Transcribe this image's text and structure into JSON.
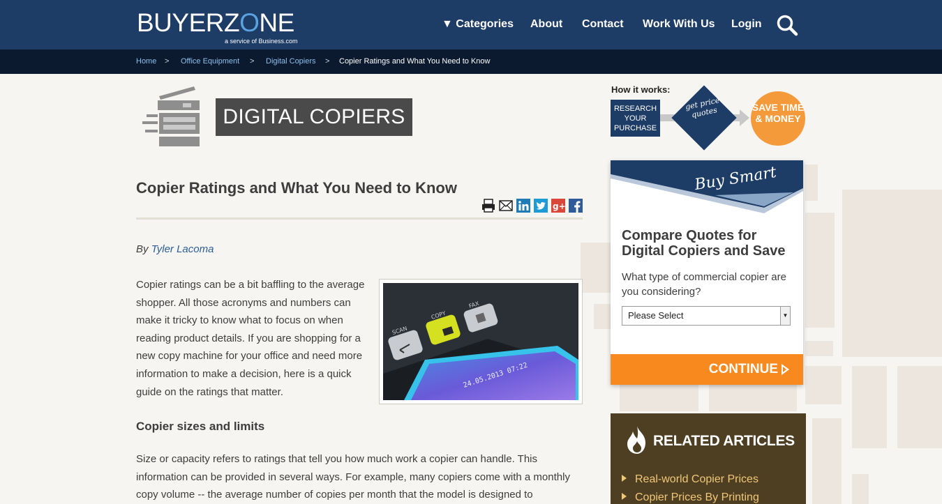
{
  "header": {
    "logo_main": "BUYERZ",
    "logo_o": "O",
    "logo_end": "NE",
    "logo_sub": "a service of Business.com",
    "nav": [
      "▼ Categories",
      "About",
      "Contact",
      "Work With Us",
      "Login"
    ],
    "search_icon": "search-icon"
  },
  "breadcrumb": {
    "items": [
      "Home",
      "Office Equipment",
      "Digital Copiers"
    ],
    "current": "Copier Ratings and What You Need to Know",
    "separator": ">"
  },
  "category": {
    "icon": "copier-icon",
    "banner": "DIGITAL COPIERS"
  },
  "article": {
    "title": "Copier Ratings and What You Need to Know",
    "share_icons": [
      "print-icon",
      "email-icon",
      "linkedin-icon",
      "twitter-icon",
      "googleplus-icon",
      "facebook-icon"
    ],
    "byline_prefix": "By",
    "author": "Tyler Lacoma",
    "intro": "Copier ratings can be a bit baffling to the average shopper. All those acronyms and numbers can make it tricky to know what to focus on when reading product details. If you are shopping for a new copy machine for your office and need more information to make a decision, here is a quick guide on the ratings that matter.",
    "photo_labels": {
      "scan": "SCAN",
      "copy": "COPY",
      "fax": "FAX",
      "date": "24.05.2013 07:22"
    },
    "subhead": "Copier sizes and limits",
    "body": "Size or capacity refers to ratings that tell you how much work a copier can handle. This information can be provided in several ways. For example, many copiers come with a monthly copy volume -- the average number of copies per month that the model is designed to"
  },
  "how_it_works": {
    "label": "How it works:",
    "step1": "RESEARCH YOUR PURCHASE",
    "step2": "get price quotes",
    "step3": "SAVE TIME & MONEY"
  },
  "quote": {
    "banner": "Buy Smart",
    "title": "Compare Quotes for Digital Copiers and Save",
    "question": "What type of commercial copier are you considering?",
    "select_value": "Please Select",
    "continue_label": "CONTINUE"
  },
  "related": {
    "title": "RELATED ARTICLES",
    "items": [
      "Real-world Copier Prices",
      "Copier Prices By Printing"
    ]
  },
  "colors": {
    "header_bg": "#1d3c66",
    "breadcrumb_bg": "#0b1a2f",
    "accent_orange": "#f7891f",
    "link_blue": "#2b5d9a",
    "related_bg": "#4e3e22"
  }
}
